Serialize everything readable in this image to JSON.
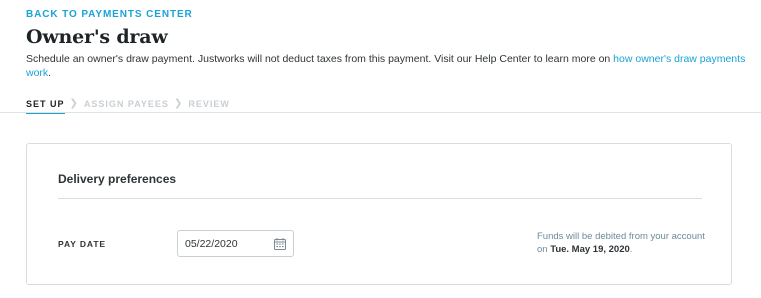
{
  "header": {
    "back_link": "BACK TO PAYMENTS CENTER",
    "title": "Owner's draw",
    "intro_text": "Schedule an owner's draw payment. Justworks will not deduct taxes from this payment. Visit our Help Center to learn more on ",
    "intro_link": "how owner's draw payments work",
    "intro_end": "."
  },
  "stepper": {
    "steps": [
      "SET UP",
      "ASSIGN PAYEES",
      "REVIEW"
    ],
    "active_index": 0
  },
  "card": {
    "title": "Delivery preferences",
    "pay_date_label": "PAY DATE",
    "pay_date_value": "05/22/2020",
    "note_prefix": "Funds will be debited from your account on ",
    "note_date": "Tue. May 19, 2020",
    "note_suffix": "."
  },
  "colors": {
    "accent": "#1aa3d6",
    "inactive_step": "#c9cfd3"
  }
}
